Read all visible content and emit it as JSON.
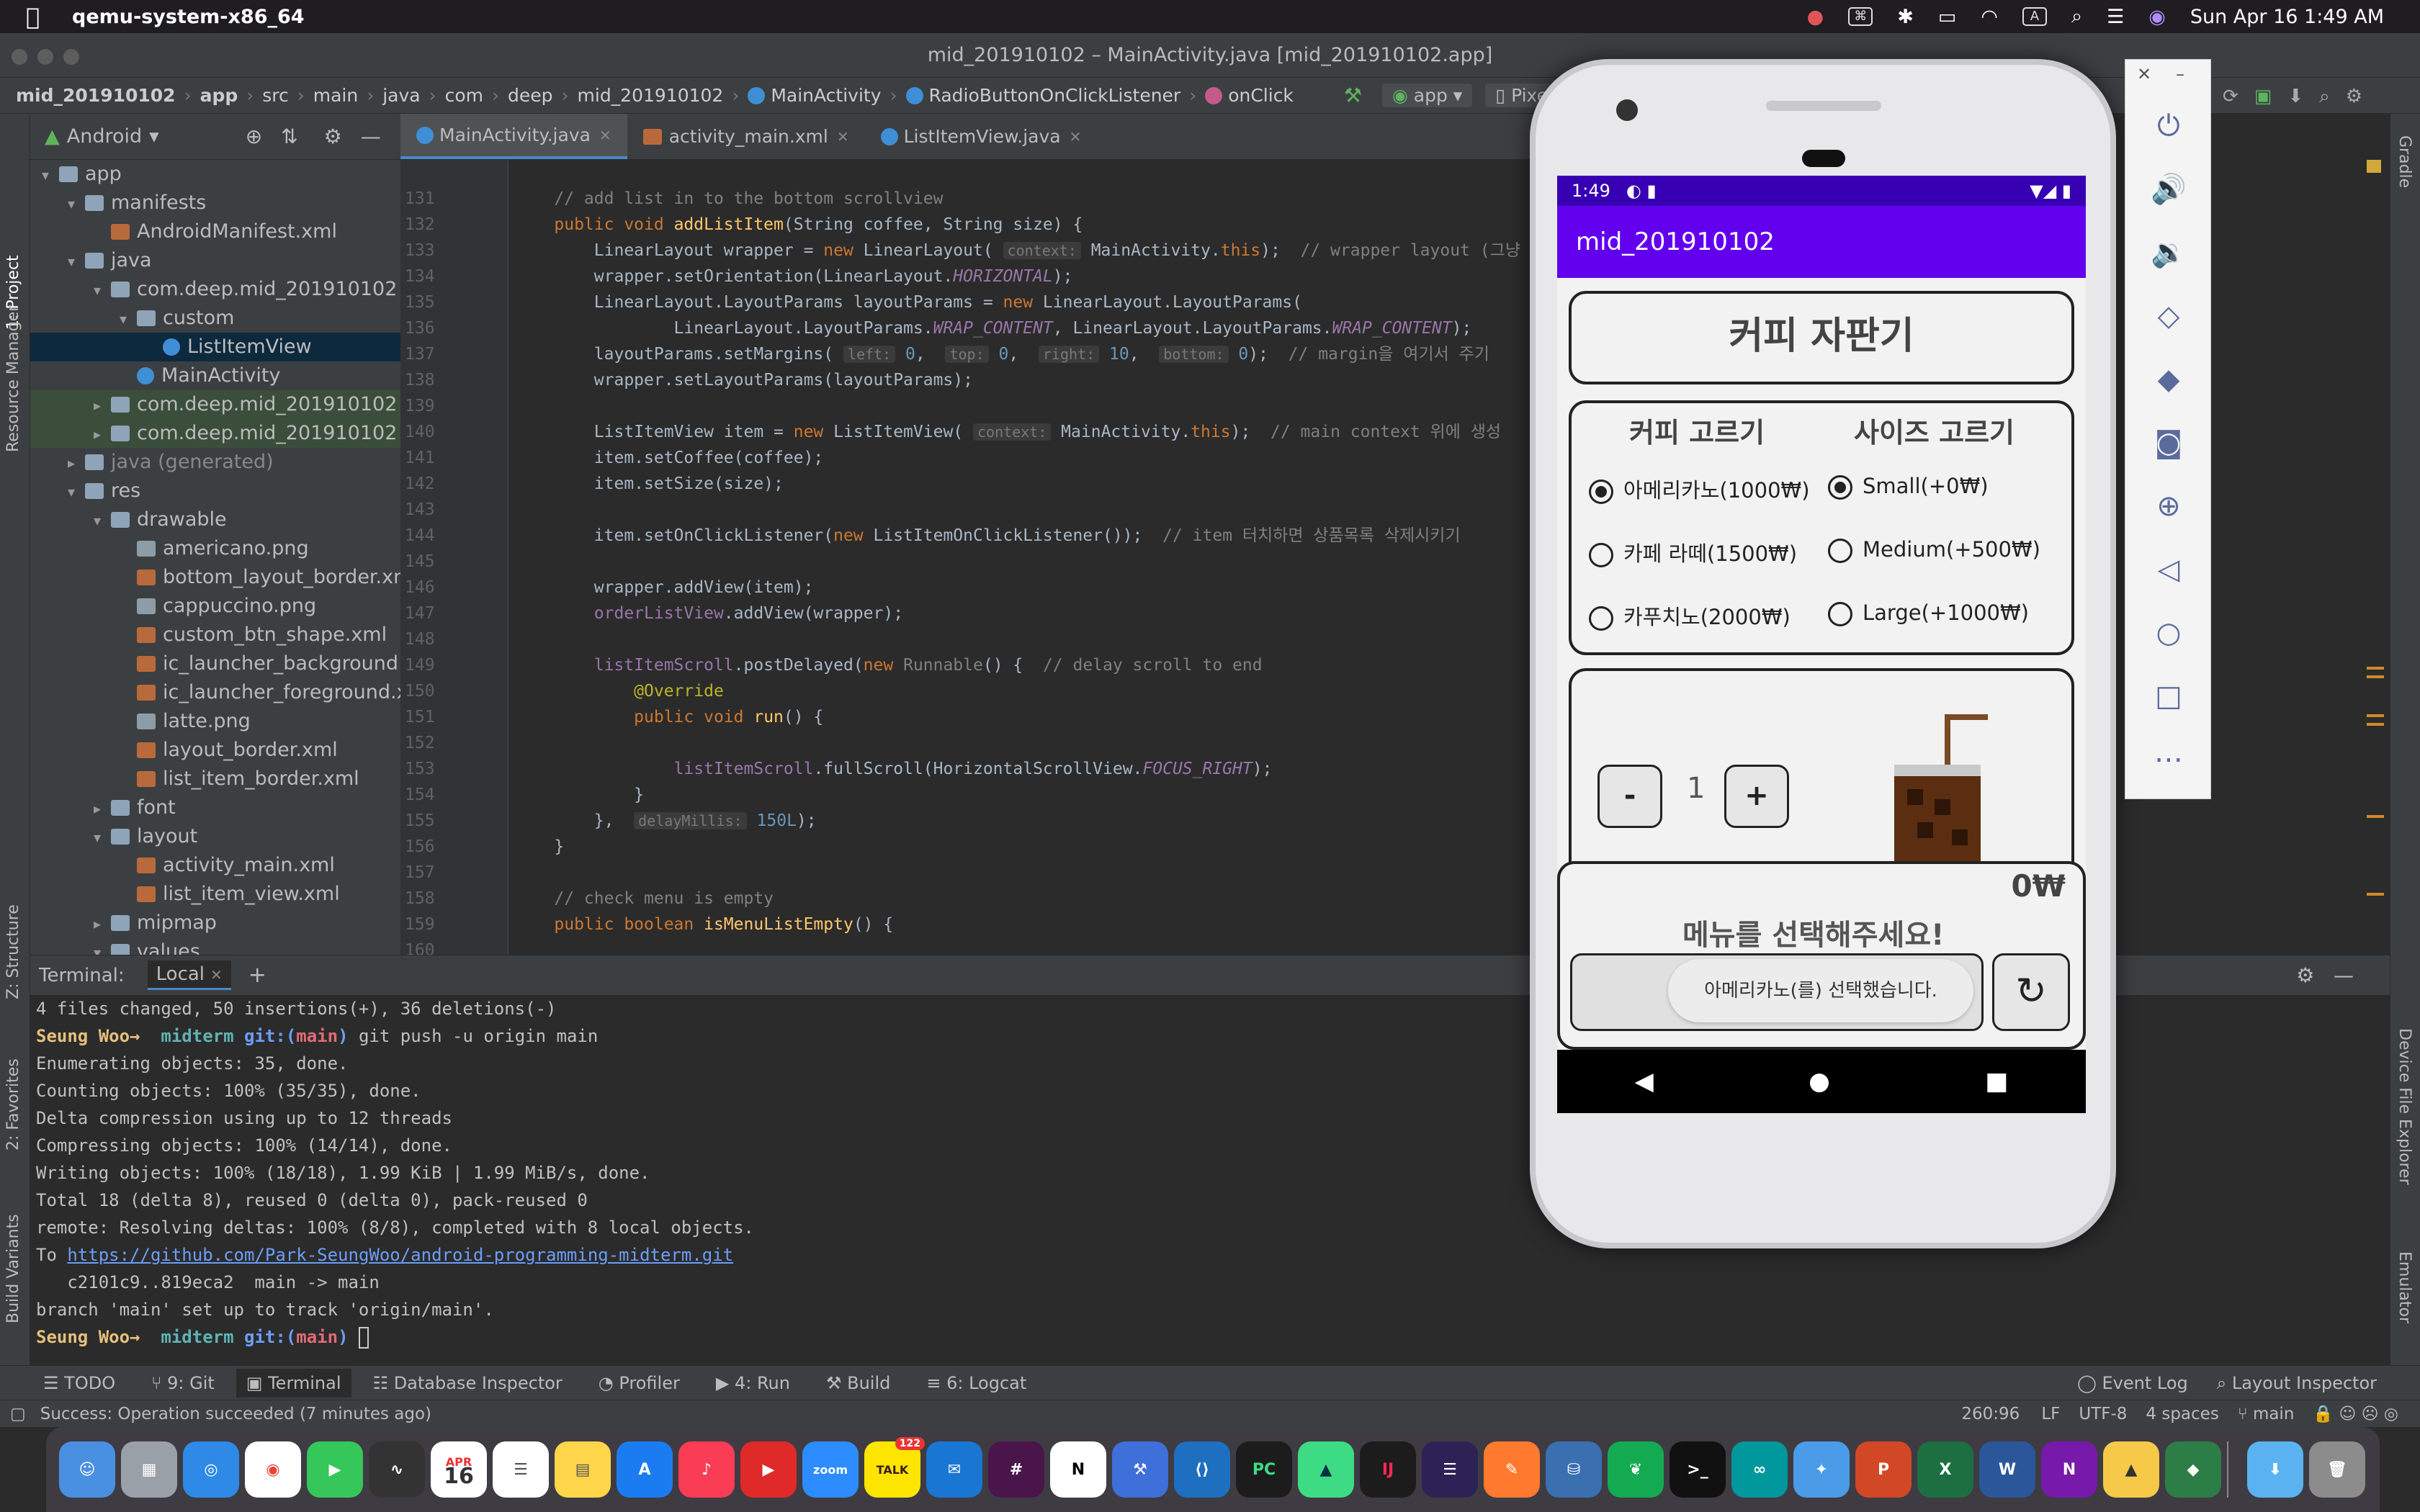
{
  "menubar": {
    "app_name": "qemu-system-x86_64",
    "datetime": "Sun Apr 16  1:49 AM"
  },
  "window": {
    "title": "mid_201910102 – MainActivity.java [mid_201910102.app]"
  },
  "breadcrumb": {
    "items": [
      "mid_201910102",
      "app",
      "src",
      "main",
      "java",
      "com",
      "deep",
      "mid_201910102",
      "MainActivity",
      "RadioButtonOnClickListener",
      "onClick"
    ],
    "run_config": "app",
    "device": "Pixe"
  },
  "project_panel": {
    "view": "Android",
    "tree": [
      {
        "label": "app",
        "depth": 0,
        "type": "folder",
        "arrow": "▾"
      },
      {
        "label": "manifests",
        "depth": 1,
        "type": "folder",
        "arrow": "▾"
      },
      {
        "label": "AndroidManifest.xml",
        "depth": 2,
        "type": "xml",
        "arrow": ""
      },
      {
        "label": "java",
        "depth": 1,
        "type": "folder",
        "arrow": "▾"
      },
      {
        "label": "com.deep.mid_201910102",
        "depth": 2,
        "type": "folder",
        "arrow": "▾"
      },
      {
        "label": "custom",
        "depth": 3,
        "type": "folder",
        "arrow": "▾"
      },
      {
        "label": "ListItemView",
        "depth": 4,
        "type": "class",
        "arrow": "",
        "selected": true
      },
      {
        "label": "MainActivity",
        "depth": 3,
        "type": "class",
        "arrow": ""
      },
      {
        "label": "com.deep.mid_201910102 (",
        "depth": 2,
        "type": "folder",
        "arrow": "▸",
        "modified": true
      },
      {
        "label": "com.deep.mid_201910102 (",
        "depth": 2,
        "type": "folder",
        "arrow": "▸",
        "modified": true
      },
      {
        "label": "java (generated)",
        "depth": 1,
        "type": "folder",
        "arrow": "▸"
      },
      {
        "label": "res",
        "depth": 1,
        "type": "folder",
        "arrow": "▾"
      },
      {
        "label": "drawable",
        "depth": 2,
        "type": "folder",
        "arrow": "▾"
      },
      {
        "label": "americano.png",
        "depth": 3,
        "type": "png",
        "arrow": ""
      },
      {
        "label": "bottom_layout_border.xn",
        "depth": 3,
        "type": "xml",
        "arrow": ""
      },
      {
        "label": "cappuccino.png",
        "depth": 3,
        "type": "png",
        "arrow": ""
      },
      {
        "label": "custom_btn_shape.xml",
        "depth": 3,
        "type": "xml",
        "arrow": ""
      },
      {
        "label": "ic_launcher_background",
        "depth": 3,
        "type": "xml",
        "arrow": ""
      },
      {
        "label": "ic_launcher_foreground.x",
        "depth": 3,
        "type": "xml",
        "arrow": ""
      },
      {
        "label": "latte.png",
        "depth": 3,
        "type": "png",
        "arrow": ""
      },
      {
        "label": "layout_border.xml",
        "depth": 3,
        "type": "xml",
        "arrow": ""
      },
      {
        "label": "list_item_border.xml",
        "depth": 3,
        "type": "xml",
        "arrow": ""
      },
      {
        "label": "font",
        "depth": 2,
        "type": "folder",
        "arrow": "▸"
      },
      {
        "label": "layout",
        "depth": 2,
        "type": "folder",
        "arrow": "▾"
      },
      {
        "label": "activity_main.xml",
        "depth": 3,
        "type": "xml",
        "arrow": ""
      },
      {
        "label": "list_item_view.xml",
        "depth": 3,
        "type": "xml",
        "arrow": ""
      },
      {
        "label": "mipmap",
        "depth": 2,
        "type": "folder",
        "arrow": "▸"
      },
      {
        "label": "values",
        "depth": 2,
        "type": "folder",
        "arrow": "▾"
      }
    ]
  },
  "editor": {
    "tabs": [
      {
        "label": "MainActivity.java",
        "active": true
      },
      {
        "label": "activity_main.xml",
        "active": false
      },
      {
        "label": "ListItemView.java",
        "active": false
      }
    ],
    "line_numbers": [
      "131",
      "132",
      "133",
      "134",
      "135",
      "136",
      "137",
      "138",
      "139",
      "140",
      "141",
      "142",
      "143",
      "144",
      "145",
      "146",
      "147",
      "148",
      "149",
      "150",
      "151",
      "152",
      "153",
      "154",
      "155",
      "156",
      "157",
      "158",
      "159",
      "160"
    ]
  },
  "left_stripe": [
    "1: Project",
    "Resource Manager",
    "Z: Structure",
    "2: Favorites",
    "Build Variants"
  ],
  "right_stripe": [
    "Gradle",
    "Device File Explorer",
    "Emulator"
  ],
  "terminal": {
    "label": "Terminal:",
    "tab": "Local",
    "lines": [
      "4 files changed, 50 insertions(+), 36 deletions(-)",
      "Enumerating objects: 35, done.",
      "Counting objects: 100% (35/35), done.",
      "Delta compression using up to 12 threads",
      "Compressing objects: 100% (14/14), done.",
      "Writing objects: 100% (18/18), 1.99 KiB | 1.99 MiB/s, done.",
      "Total 18 (delta 8), reused 0 (delta 0), pack-reused 0",
      "remote: Resolving deltas: 100% (8/8), completed with 8 local objects.",
      "   c2101c9..819eca2  main -> main",
      "branch 'main' set up to track 'origin/main'."
    ],
    "prompt_user": "Seung Woo→",
    "prompt_dir": "midterm",
    "prompt_git": "git:(",
    "prompt_branch": "main",
    "prompt_close": ")",
    "push_cmd": "git push -u origin main",
    "to_label": "To",
    "remote_url": "https://github.com/Park-SeungWoo/android-programming-midterm.git"
  },
  "bottom_tools": [
    "TODO",
    "9: Git",
    "Terminal",
    "Database Inspector",
    "Profiler",
    "4: Run",
    "Build",
    "6: Logcat"
  ],
  "bottom_tools_right": [
    "Event Log",
    "Layout Inspector"
  ],
  "status": {
    "message": "Success: Operation succeeded (7 minutes ago)",
    "position": "260:96",
    "line_sep": "LF",
    "encoding": "UTF-8",
    "indent": "4 spaces",
    "branch": "main"
  },
  "dock": {
    "badge": "122",
    "calendar_month": "APR",
    "calendar_day": "16"
  },
  "phone": {
    "time": "1:49",
    "app_title": "mid_201910102",
    "machine_title": "커피 자판기",
    "coffee_header": "커피 고르기",
    "size_header": "사이즈 고르기",
    "coffee_options": [
      {
        "label": "아메리카노(1000₩)",
        "checked": true
      },
      {
        "label": "카페 라떼(1500₩)",
        "checked": false
      },
      {
        "label": "카푸치노(2000₩)",
        "checked": false
      }
    ],
    "size_options": [
      {
        "label": "Small(+0₩)",
        "checked": true
      },
      {
        "label": "Medium(+500₩)",
        "checked": false
      },
      {
        "label": "Large(+1000₩)",
        "checked": false
      }
    ],
    "minus": "-",
    "qty": "1",
    "plus": "+",
    "total": "0₩",
    "empty_message": "메뉴를 선택해주세요!",
    "toast": "아메리카노(를) 선택했습니다.",
    "reset_icon": "↻"
  }
}
